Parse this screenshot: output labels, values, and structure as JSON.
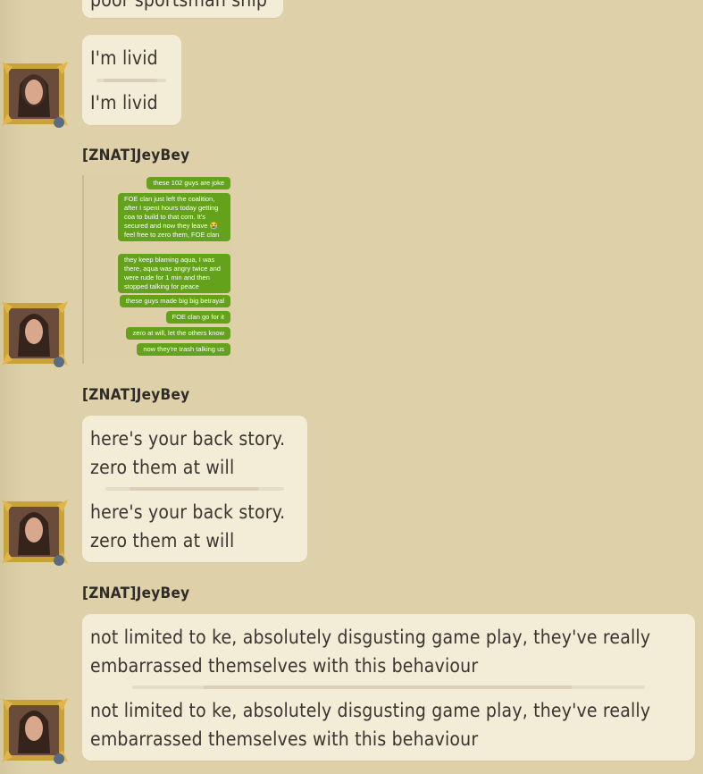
{
  "messages": [
    {
      "first": "poor sportsman ship"
    },
    {
      "first": "I'm livid",
      "second": "I'm livid"
    }
  ],
  "author": "[ZNAT]JeyBey",
  "screenshot": {
    "bubbles": [
      {
        "text": "these 102 guys are joke"
      },
      {
        "text": "FOE clan just left the coalition, after I spent hours today getting coa to build to that com. It's secured and now they leave 😭 feel free to zero them, FOE clan"
      },
      {
        "text": "they keep blaming aqua, I was there, aqua was angry twice and were rude for 1 min and then stopped talking for peace"
      },
      {
        "text": "these guys made big big betrayal"
      },
      {
        "text": "FOE clan go for it"
      },
      {
        "text": "zero at will, let the others know"
      },
      {
        "text": "now they're trash talking us"
      }
    ]
  },
  "backstory": {
    "line1": "here's your back story.",
    "line2": "zero them at will"
  },
  "final": {
    "line1": "not limited to ke, absolutely disgusting game play, they've really",
    "line2": "embarrassed themselves with this behaviour"
  },
  "colors": {
    "background": "#ded1aa",
    "bubble": "#f3ecd7",
    "sms_green": "#63a21a",
    "frame_gold": "#c9a23a"
  }
}
